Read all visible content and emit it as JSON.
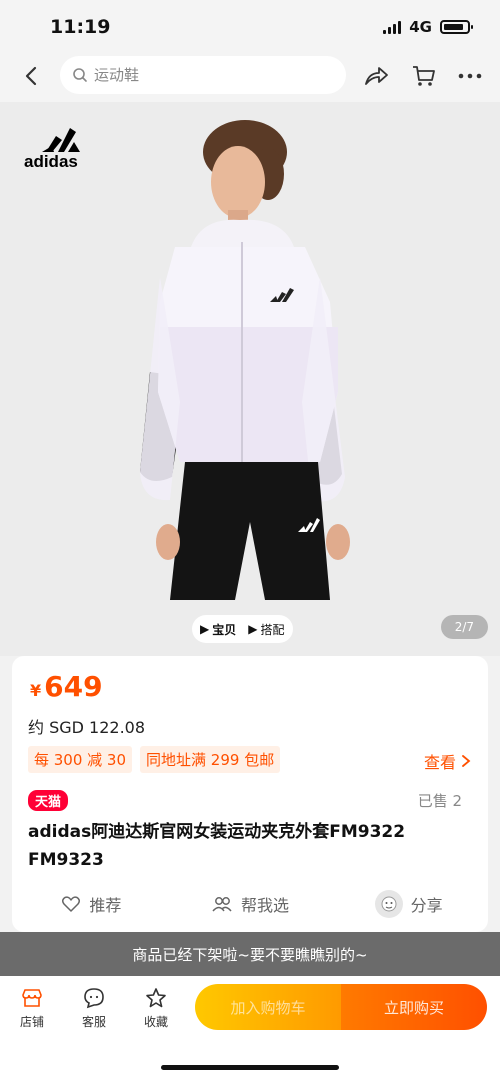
{
  "status_bar": {
    "time": "11:19",
    "network": "4G"
  },
  "nav": {
    "search_placeholder": "运动鞋",
    "icons": [
      "back-icon",
      "search-icon",
      "share-icon",
      "cart-icon",
      "more-icon"
    ]
  },
  "gallery": {
    "brand_logo": "adidas",
    "tabs": [
      {
        "label": "宝贝"
      },
      {
        "label": "搭配"
      }
    ],
    "page_indicator": "2/7"
  },
  "product": {
    "currency_symbol": "¥",
    "price": "649",
    "approx_price": "约 SGD 122.08",
    "promos": [
      {
        "label": "每 300 减 30"
      },
      {
        "label": "同地址满 299 包邮"
      }
    ],
    "view_label": "查看",
    "store_badge": "天猫",
    "sold": "已售 2",
    "title": "adidas阿迪达斯官网女装运动夹克外套FM9322 FM9323",
    "actions": [
      {
        "label": "推荐"
      },
      {
        "label": "帮我选"
      },
      {
        "label": "分享"
      }
    ]
  },
  "notice": "商品已经下架啦~要不要瞧瞧别的~",
  "bottom_bar": {
    "items": [
      {
        "label": "店铺"
      },
      {
        "label": "客服"
      },
      {
        "label": "收藏"
      }
    ],
    "add_to_cart": "加入购物车",
    "buy_now": "立即购买"
  },
  "colors": {
    "accent": "#ff5000",
    "tmall": "#ff0036",
    "cart_gradient_start": "#ffc800"
  }
}
